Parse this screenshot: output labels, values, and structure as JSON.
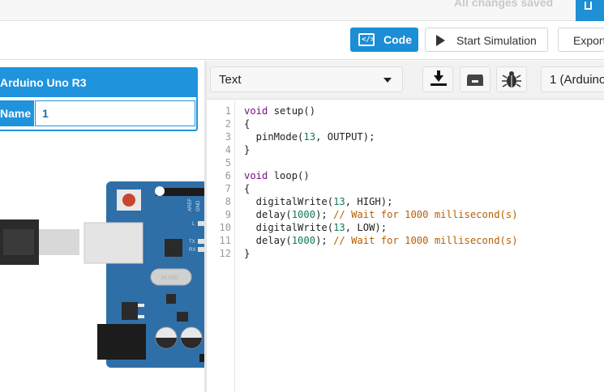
{
  "topbar": {
    "status": "All changes saved"
  },
  "toolbar": {
    "code_label": "Code",
    "code_icon_glyph": "</>",
    "simulate_label": "Start Simulation",
    "export_label": "Export"
  },
  "component_panel": {
    "title": "Arduino Uno R3",
    "name_label": "Name",
    "name_value": "1"
  },
  "board": {
    "pin_labels": [
      "AREF",
      "GND"
    ],
    "led_labels": [
      "L",
      "TX",
      "RX"
    ],
    "crystal_label": "16.000"
  },
  "editor": {
    "mode": "Text",
    "serial_label": "1 (Arduino",
    "icons": [
      "download-icon",
      "library-icon",
      "debugger-bug-icon"
    ],
    "lines": [
      {
        "n": "1",
        "parts": [
          {
            "t": "void",
            "c": "kw"
          },
          {
            "t": " setup()",
            "c": ""
          }
        ]
      },
      {
        "n": "2",
        "parts": [
          {
            "t": "{",
            "c": ""
          }
        ]
      },
      {
        "n": "3",
        "parts": [
          {
            "t": "  pinMode(",
            "c": ""
          },
          {
            "t": "13",
            "c": "num"
          },
          {
            "t": ", OUTPUT);",
            "c": ""
          }
        ]
      },
      {
        "n": "4",
        "parts": [
          {
            "t": "}",
            "c": ""
          }
        ]
      },
      {
        "n": "5",
        "parts": []
      },
      {
        "n": "6",
        "parts": [
          {
            "t": "void",
            "c": "kw"
          },
          {
            "t": " loop()",
            "c": ""
          }
        ]
      },
      {
        "n": "7",
        "parts": [
          {
            "t": "{",
            "c": ""
          }
        ]
      },
      {
        "n": "8",
        "parts": [
          {
            "t": "  digitalWrite(",
            "c": ""
          },
          {
            "t": "13",
            "c": "num"
          },
          {
            "t": ", HIGH);",
            "c": ""
          }
        ]
      },
      {
        "n": "9",
        "parts": [
          {
            "t": "  delay(",
            "c": ""
          },
          {
            "t": "1000",
            "c": "num"
          },
          {
            "t": "); ",
            "c": ""
          },
          {
            "t": "// Wait for 1000 millisecond(s)",
            "c": "cm"
          }
        ]
      },
      {
        "n": "10",
        "parts": [
          {
            "t": "  digitalWrite(",
            "c": ""
          },
          {
            "t": "13",
            "c": "num"
          },
          {
            "t": ", LOW);",
            "c": ""
          }
        ]
      },
      {
        "n": "11",
        "parts": [
          {
            "t": "  delay(",
            "c": ""
          },
          {
            "t": "1000",
            "c": "num"
          },
          {
            "t": "); ",
            "c": ""
          },
          {
            "t": "// Wait for 1000 millisecond(s)",
            "c": "cm"
          }
        ]
      },
      {
        "n": "12",
        "parts": [
          {
            "t": "}",
            "c": ""
          }
        ]
      }
    ]
  },
  "colors": {
    "accent": "#1b8ed5",
    "board": "#2f6fa8",
    "keyword": "#7a0e8a",
    "number": "#117a55",
    "comment": "#b65f00"
  }
}
